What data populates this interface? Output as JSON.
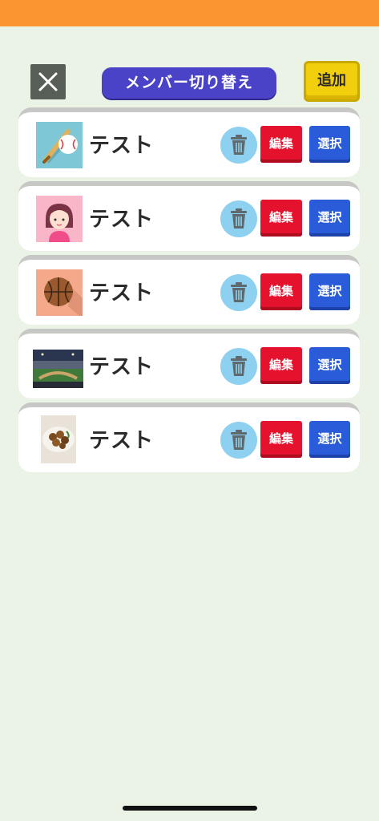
{
  "header": {
    "title": "メンバー切り替え",
    "add_label": "追加",
    "close_icon": "close-icon"
  },
  "members": [
    {
      "name": "テスト",
      "avatar": "baseball-bat-icon",
      "edit_label": "編集",
      "select_label": "選択",
      "delete_icon": "trash-icon"
    },
    {
      "name": "テスト",
      "avatar": "girl-avatar-icon",
      "edit_label": "編集",
      "select_label": "選択",
      "delete_icon": "trash-icon"
    },
    {
      "name": "テスト",
      "avatar": "basketball-icon",
      "edit_label": "編集",
      "select_label": "選択",
      "delete_icon": "trash-icon"
    },
    {
      "name": "テスト",
      "avatar": "stadium-photo",
      "edit_label": "編集",
      "select_label": "選択",
      "delete_icon": "trash-icon"
    },
    {
      "name": "テスト",
      "avatar": "food-photo",
      "edit_label": "編集",
      "select_label": "選択",
      "delete_icon": "trash-icon"
    }
  ],
  "colors": {
    "top_bar": "#fa9632",
    "background": "#eaf3e6",
    "title_pill": "#4a43c7",
    "add_button": "#f2cf0c",
    "edit_button": "#e4122d",
    "select_button": "#2a5bd9",
    "trash_button": "#8ed0ef"
  }
}
